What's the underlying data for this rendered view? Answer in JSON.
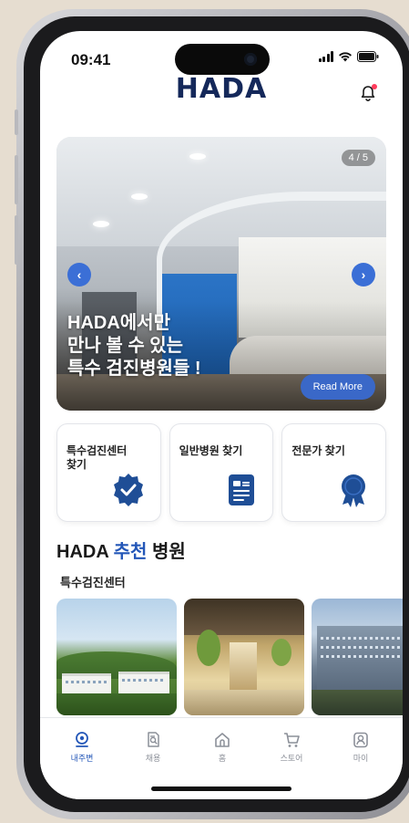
{
  "status_bar": {
    "time": "09:41"
  },
  "header": {
    "logo_text": "HADA"
  },
  "banner": {
    "counter": "4 / 5",
    "title_lines": [
      "HADA에서만",
      "만나 볼 수 있는",
      "특수 검진병원들 !"
    ],
    "read_more": "Read More",
    "prev_icon": "chevron-left-icon",
    "next_icon": "chevron-right-icon"
  },
  "quick_cards": [
    {
      "label": "특수검진센터\n찾기",
      "icon": "badge-check-icon"
    },
    {
      "label": "일반병원 찾기",
      "icon": "document-icon"
    },
    {
      "label": "전문가 찾기",
      "icon": "award-icon"
    }
  ],
  "recommend": {
    "title_prefix": "HADA ",
    "title_accent": "추천",
    "title_suffix": " 병원",
    "subtitle": "특수검진센터"
  },
  "tabbar": {
    "items": [
      {
        "label": "내주변",
        "icon": "location-icon",
        "active": true
      },
      {
        "label": "채용",
        "icon": "job-search-icon",
        "active": false
      },
      {
        "label": "홈",
        "icon": "home-icon",
        "active": false
      },
      {
        "label": "스토어",
        "icon": "cart-icon",
        "active": false
      },
      {
        "label": "마이",
        "icon": "profile-icon",
        "active": false
      }
    ]
  },
  "colors": {
    "brand_navy": "#14285a",
    "accent_blue": "#2457b8",
    "button_blue": "#3a68c8",
    "notification_dot": "#ff3b5c"
  }
}
